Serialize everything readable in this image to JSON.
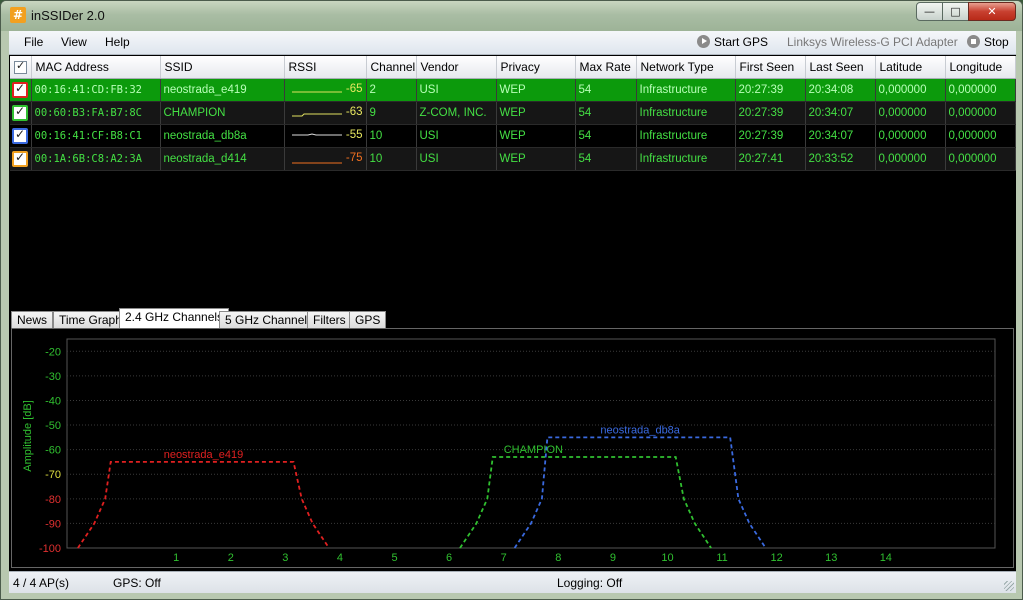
{
  "window": {
    "title": "inSSIDer 2.0",
    "app_icon_glyph": "#"
  },
  "caption_buttons": {
    "minimize": "—",
    "maximize": "□",
    "close": "✕"
  },
  "menu": {
    "file": "File",
    "view": "View",
    "help": "Help"
  },
  "toolbar": {
    "start_gps": "Start GPS",
    "adapter": "Linksys Wireless-G PCI Adapter",
    "stop": "Stop"
  },
  "table": {
    "columns": [
      "MAC Address",
      "SSID",
      "RSSI",
      "Channel",
      "Vendor",
      "Privacy",
      "Max Rate",
      "Network Type",
      "First Seen",
      "Last Seen",
      "Latitude",
      "Longitude"
    ],
    "rows": [
      {
        "color": "#e02020",
        "mac": "00:16:41:CD:FB:32",
        "ssid": "neostrada_e419",
        "rssi": "-65",
        "channel": "2",
        "vendor": "USI",
        "privacy": "WEP",
        "max_rate": "54",
        "network_type": "Infrastructure",
        "first_seen": "20:27:39",
        "last_seen": "20:34:08",
        "latitude": "0,000000",
        "longitude": "0,000000"
      },
      {
        "color": "#30c030",
        "mac": "00:60:B3:FA:B7:8C",
        "ssid": "CHAMPION",
        "rssi": "-63",
        "channel": "9",
        "vendor": "Z-COM, INC.",
        "privacy": "WEP",
        "max_rate": "54",
        "network_type": "Infrastructure",
        "first_seen": "20:27:39",
        "last_seen": "20:34:07",
        "latitude": "0,000000",
        "longitude": "0,000000"
      },
      {
        "color": "#3a6ae0",
        "mac": "00:16:41:CF:B8:C1",
        "ssid": "neostrada_db8a",
        "rssi": "-55",
        "channel": "10",
        "vendor": "USI",
        "privacy": "WEP",
        "max_rate": "54",
        "network_type": "Infrastructure",
        "first_seen": "20:27:39",
        "last_seen": "20:34:07",
        "latitude": "0,000000",
        "longitude": "0,000000"
      },
      {
        "color": "#f0a020",
        "mac": "00:1A:6B:C8:A2:3A",
        "ssid": "neostrada_d414",
        "rssi": "-75",
        "channel": "10",
        "vendor": "USI",
        "privacy": "WEP",
        "max_rate": "54",
        "network_type": "Infrastructure",
        "first_seen": "20:27:41",
        "last_seen": "20:33:52",
        "latitude": "0,000000",
        "longitude": "0,000000"
      }
    ]
  },
  "tabs": [
    {
      "label": "News"
    },
    {
      "label": "Time Graph"
    },
    {
      "label": "2.4 GHz Channels",
      "active": true
    },
    {
      "label": "5 GHz Channels"
    },
    {
      "label": "Filters"
    },
    {
      "label": "GPS"
    }
  ],
  "chart_data": {
    "type": "line",
    "ylabel": "Amplitude [dB]",
    "ylim": [
      -100,
      -15
    ],
    "yticks": [
      -20,
      -30,
      -40,
      -50,
      -60,
      -70,
      -80,
      -90,
      -100
    ],
    "xlim": [
      -1,
      16
    ],
    "xticks": [
      1,
      2,
      3,
      4,
      5,
      6,
      7,
      8,
      9,
      10,
      11,
      12,
      13,
      14
    ],
    "grid": true,
    "series": [
      {
        "name": "neostrada_e419",
        "channel": 2,
        "amplitude": -65,
        "color": "#e02020"
      },
      {
        "name": "CHAMPION",
        "channel": 9,
        "amplitude": -63,
        "color": "#30c030"
      },
      {
        "name": "neostrada_db8a",
        "channel": 10,
        "amplitude": -55,
        "color": "#3a6ae0"
      }
    ]
  },
  "status": {
    "aps": "4 / 4 AP(s)",
    "gps": "GPS: Off",
    "logging": "Logging: Off"
  }
}
